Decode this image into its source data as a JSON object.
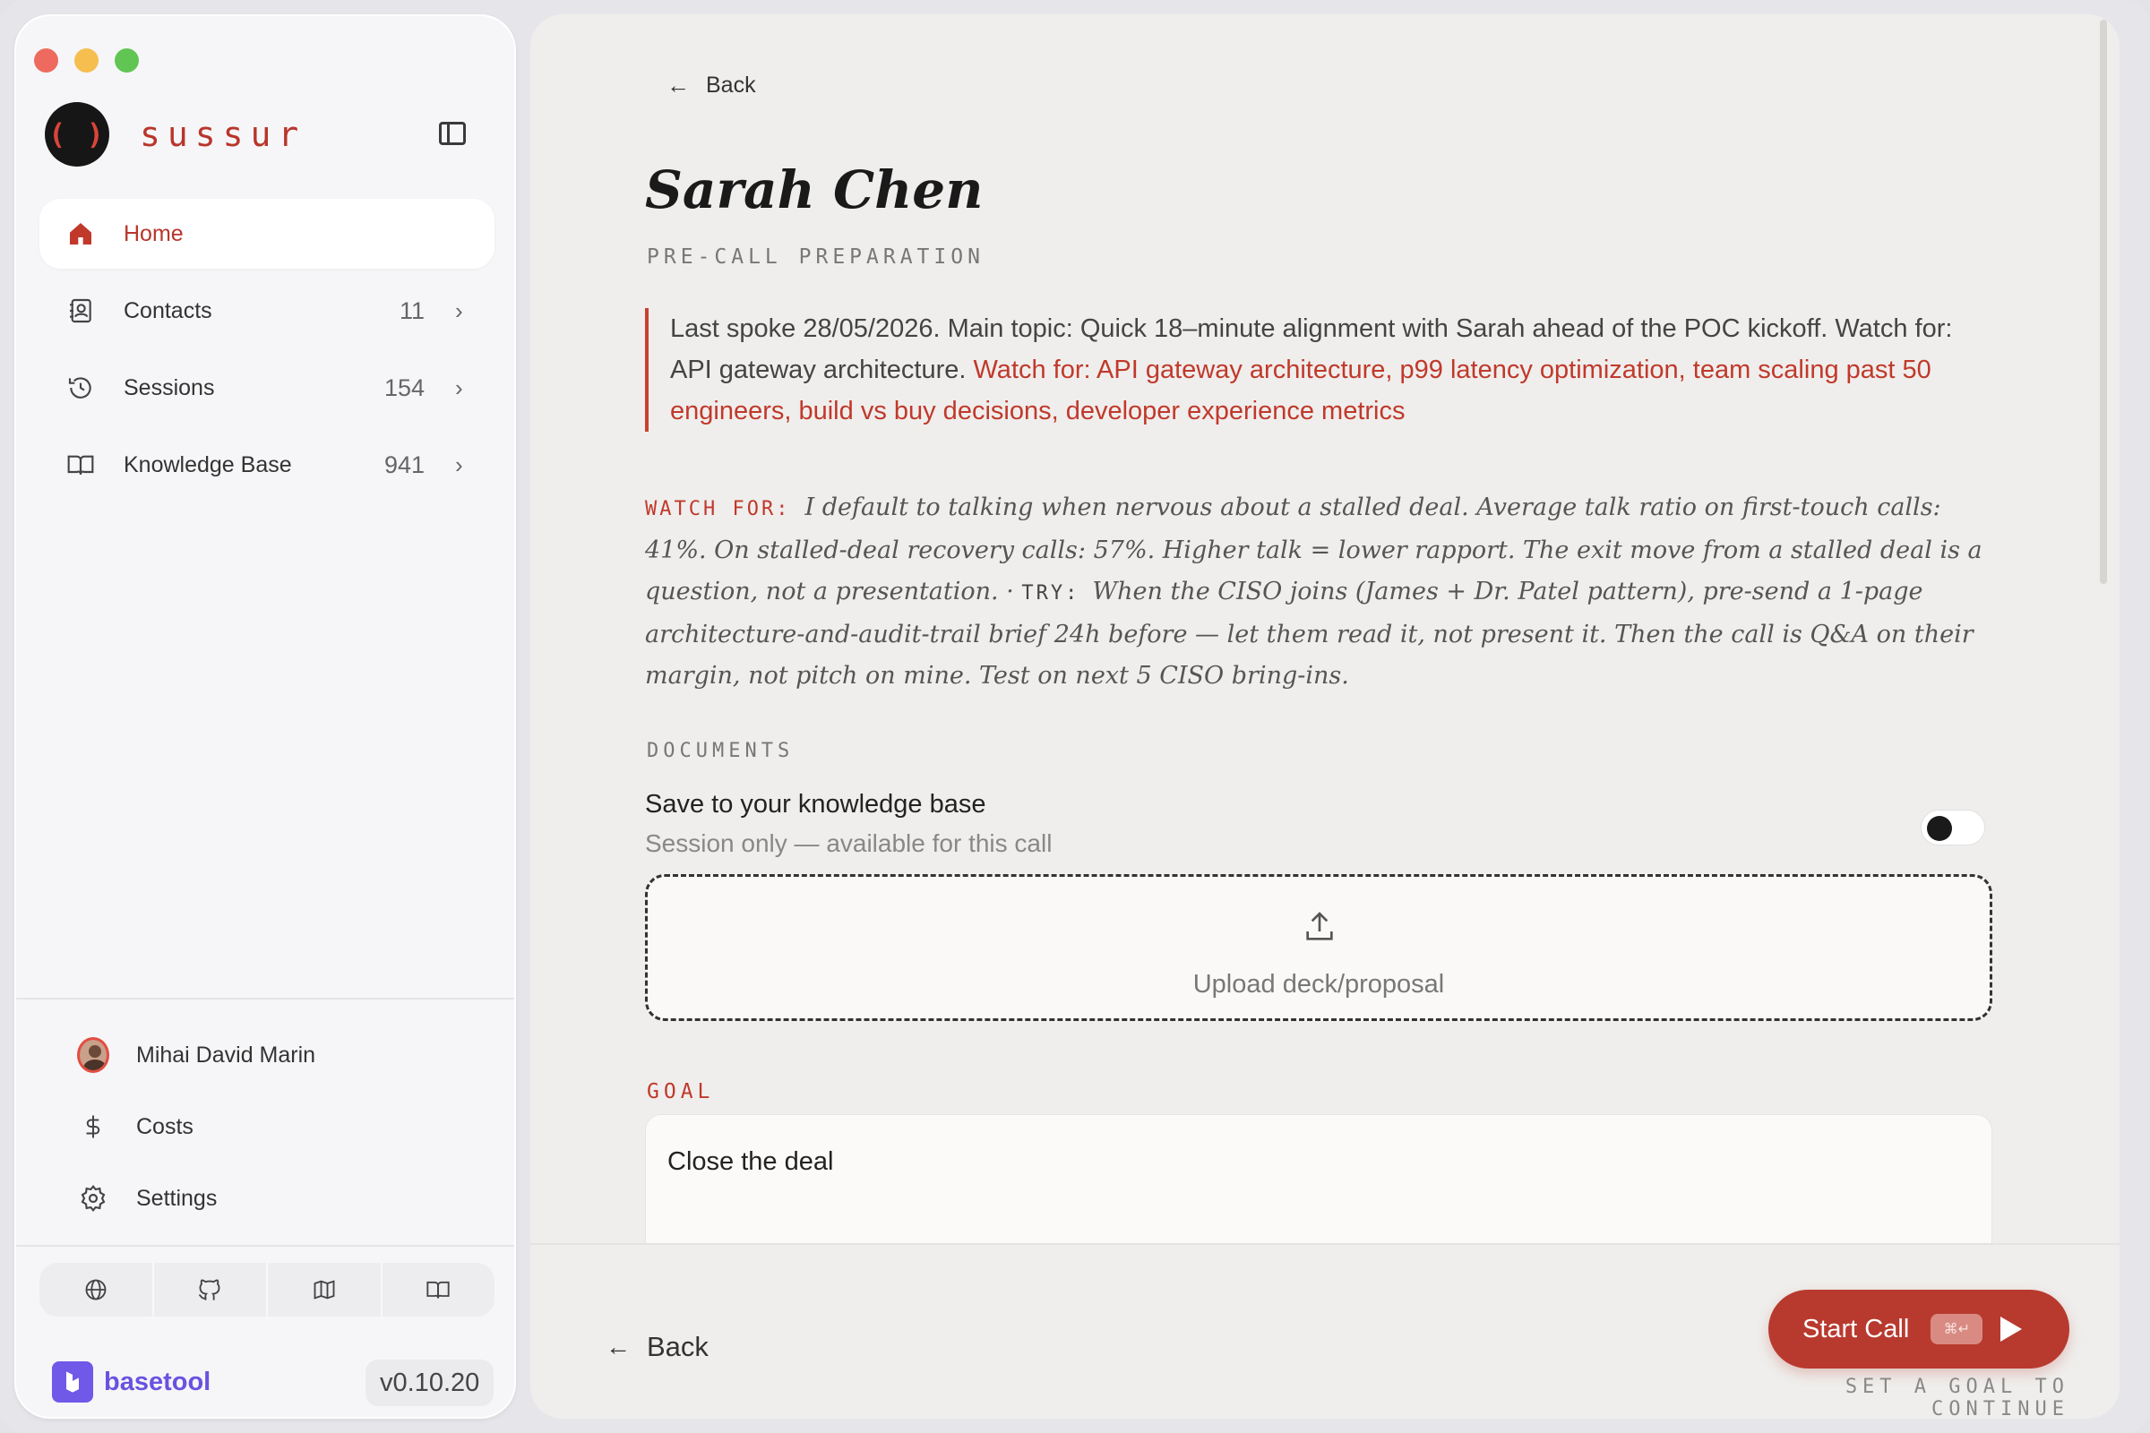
{
  "brand": {
    "logo_glyph": "( )",
    "name": "sussur"
  },
  "nav": {
    "items": [
      {
        "label": "Home",
        "count": null,
        "active": true
      },
      {
        "label": "Contacts",
        "count": "11"
      },
      {
        "label": "Sessions",
        "count": "154"
      },
      {
        "label": "Knowledge Base",
        "count": "941"
      }
    ]
  },
  "bottom_nav": {
    "user_name": "Mihai David Marin",
    "costs_label": "Costs",
    "settings_label": "Settings"
  },
  "footer": {
    "brand_name": "basetool",
    "version": "v0.10.20"
  },
  "main": {
    "back_label": "Back",
    "title": "Sarah Chen",
    "subtitle": "PRE-CALL PREPARATION",
    "summary_plain": "Last spoke 28/05/2026. Main topic: Quick 18–minute alignment with Sarah ahead of the POC kickoff. Watch for: API gateway architecture.",
    "summary_highlight": "Watch for: API gateway architecture, p99 latency optimization, team scaling past 50 engineers, build vs buy decisions, developer experience metrics",
    "watch_label": "WATCH FOR:",
    "watch_text": "I default to talking when nervous about a stalled deal. Average talk ratio on first-touch calls: 41%. On stalled-deal recovery calls: 57%. Higher talk = lower rapport. The exit move from a stalled deal is a question, not a presentation.",
    "try_sep": "·",
    "try_label": "TRY:",
    "try_text": "When the CISO joins (James + Dr. Patel pattern), pre-send a 1-page architecture-and-audit-trail brief 24h before — let them read it, not present it. Then the call is Q&A on their margin, not pitch on mine. Test on next 5 CISO bring-ins.",
    "documents_label": "DOCUMENTS",
    "save_title": "Save to your knowledge base",
    "save_sub": "Session only — available for this call",
    "save_enabled": false,
    "upload_label": "Upload deck/proposal",
    "goal_label": "GOAL",
    "goal_value": "Close the deal"
  },
  "action_bar": {
    "back_label": "Back",
    "start_label": "Start Call",
    "shortcut": "⌘↵",
    "hint": "SET A GOAL TO CONTINUE"
  },
  "colors": {
    "accent": "#b83a2e",
    "accent_text": "#c0392b",
    "brand_purple": "#6a52e0"
  }
}
